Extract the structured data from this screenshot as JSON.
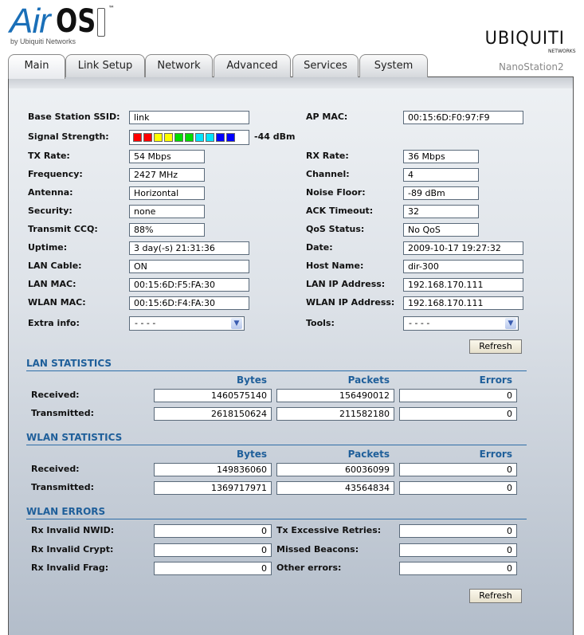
{
  "header": {
    "logo_air": "Air",
    "logo_os": "OS",
    "logo_by": "by Ubiquiti Networks",
    "brand": "UBIQUITI",
    "brand_sub": "NETWORKS",
    "model": "NanoStation2"
  },
  "tabs": [
    "Main",
    "Link Setup",
    "Network",
    "Advanced",
    "Services",
    "System"
  ],
  "active_tab": "Main",
  "status": {
    "left": [
      {
        "label": "Base Station SSID:",
        "value": "link"
      },
      {
        "label": "Signal Strength:",
        "value": "-44 dBm",
        "bars": 10,
        "bar_colors": [
          "#ff0000",
          "#ff0000",
          "#ffff00",
          "#ffff00",
          "#00dd00",
          "#00dd00",
          "#00e5ff",
          "#00e5ff",
          "#0000ff",
          "#0000ff"
        ]
      },
      {
        "label": "TX Rate:",
        "value": "54 Mbps"
      },
      {
        "label": "Frequency:",
        "value": "2427 MHz"
      },
      {
        "label": "Antenna:",
        "value": "Horizontal"
      },
      {
        "label": "Security:",
        "value": "none"
      },
      {
        "label": "Transmit CCQ:",
        "value": " 88%"
      },
      {
        "label": "Uptime:",
        "value": "3 day(-s) 21:31:36"
      },
      {
        "label": "LAN Cable:",
        "value": "ON"
      },
      {
        "label": "LAN MAC:",
        "value": "00:15:6D:F5:FA:30"
      },
      {
        "label": "WLAN MAC:",
        "value": "00:15:6D:F4:FA:30"
      },
      {
        "label": "Extra info:",
        "value": "- - - -"
      }
    ],
    "right": [
      {
        "label": "AP MAC:",
        "value": "00:15:6D:F0:97:F9"
      },
      {
        "label": "RX Rate:",
        "value": "36 Mbps"
      },
      {
        "label": "Channel:",
        "value": "4"
      },
      {
        "label": "Noise Floor:",
        "value": "-89 dBm"
      },
      {
        "label": "ACK Timeout:",
        "value": "32"
      },
      {
        "label": "QoS Status:",
        "value": "No QoS"
      },
      {
        "label": "Date:",
        "value": "2009-10-17 19:27:32"
      },
      {
        "label": "Host Name:",
        "value": "dir-300"
      },
      {
        "label": "LAN IP Address:",
        "value": "192.168.170.111"
      },
      {
        "label": "WLAN IP Address:",
        "value": "192.168.170.111"
      },
      {
        "label": "Tools:",
        "value": "- - - -"
      }
    ],
    "refresh": "Refresh"
  },
  "lan_stats": {
    "title": "LAN STATISTICS",
    "columns": [
      "Bytes",
      "Packets",
      "Errors"
    ],
    "rows": [
      {
        "label": "Received:",
        "values": [
          "1460575140",
          "156490012",
          "0"
        ]
      },
      {
        "label": "Transmitted:",
        "values": [
          "2618150624",
          "211582180",
          "0"
        ]
      }
    ]
  },
  "wlan_stats": {
    "title": "WLAN STATISTICS",
    "columns": [
      "Bytes",
      "Packets",
      "Errors"
    ],
    "rows": [
      {
        "label": "Received:",
        "values": [
          "149836060",
          "60036099",
          "0"
        ]
      },
      {
        "label": "Transmitted:",
        "values": [
          "1369717971",
          "43564834",
          "0"
        ]
      }
    ]
  },
  "wlan_errors": {
    "title": "WLAN ERRORS",
    "rows": [
      {
        "label": "Rx Invalid NWID:",
        "value": "0",
        "label2": "Tx Excessive Retries:",
        "value2": "0"
      },
      {
        "label": "Rx Invalid Crypt:",
        "value": "0",
        "label2": "Missed Beacons:",
        "value2": "0"
      },
      {
        "label": "Rx Invalid Frag:",
        "value": "0",
        "label2": "Other errors:",
        "value2": "0"
      }
    ],
    "refresh": "Refresh"
  }
}
